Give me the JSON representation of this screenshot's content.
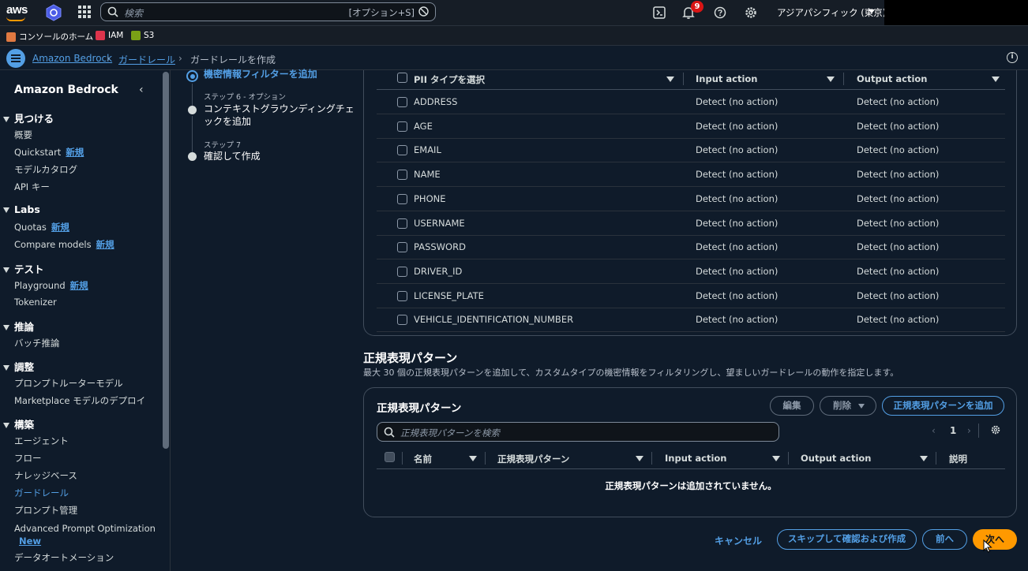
{
  "topnav": {
    "search_placeholder": "検索",
    "search_shortcut": "[オプション+S]",
    "notification_count": "9",
    "region": "アジアパシフィック (東京)"
  },
  "favorites": [
    {
      "label": "コンソールのホーム",
      "color": "#e07941"
    },
    {
      "label": "IAM",
      "color": "#dd344c"
    },
    {
      "label": "S3",
      "color": "#7aa116"
    }
  ],
  "breadcrumb": {
    "items": [
      "Amazon Bedrock",
      "ガードレール"
    ],
    "current": "ガードレールを作成"
  },
  "sidebar": {
    "title": "Amazon Bedrock",
    "sections": [
      {
        "title": "見つける",
        "items": [
          {
            "label": "概要"
          },
          {
            "label": "Quickstart",
            "tag": "新規"
          },
          {
            "label": "モデルカタログ"
          },
          {
            "label": "API キー"
          }
        ]
      },
      {
        "title": "Labs",
        "items": [
          {
            "label": "Quotas",
            "tag": "新規"
          },
          {
            "label": "Compare models",
            "tag": "新規"
          }
        ]
      },
      {
        "title": "テスト",
        "items": [
          {
            "label": "Playground",
            "tag": "新規"
          },
          {
            "label": "Tokenizer"
          }
        ]
      },
      {
        "title": "推論",
        "items": [
          {
            "label": "バッチ推論"
          }
        ]
      },
      {
        "title": "調整",
        "items": [
          {
            "label": "プロンプトルーターモデル"
          },
          {
            "label": "Marketplace モデルのデプロイ"
          }
        ]
      },
      {
        "title": "構築",
        "items": [
          {
            "label": "エージェント"
          },
          {
            "label": "フロー"
          },
          {
            "label": "ナレッジベース"
          },
          {
            "label": "ガードレール",
            "active": true
          },
          {
            "label": "プロンプト管理"
          },
          {
            "label": "Advanced Prompt Optimization",
            "tag": "New"
          },
          {
            "label": "データオートメーション"
          }
        ]
      }
    ]
  },
  "steps": {
    "active": "機密情報フィルターを追加",
    "step6_label": "ステップ 6 - オプション",
    "step6_name_l1": "コンテキストグラウンディングチェ",
    "step6_name_l2": "ックを追加",
    "step7_label": "ステップ 7",
    "step7_name": "確認して作成"
  },
  "pii_table": {
    "headers": [
      "PII タイプを選択",
      "Input action",
      "Output action"
    ],
    "rows": [
      [
        "ADDRESS",
        "Detect (no action)",
        "Detect (no action)"
      ],
      [
        "AGE",
        "Detect (no action)",
        "Detect (no action)"
      ],
      [
        "EMAIL",
        "Detect (no action)",
        "Detect (no action)"
      ],
      [
        "NAME",
        "Detect (no action)",
        "Detect (no action)"
      ],
      [
        "PHONE",
        "Detect (no action)",
        "Detect (no action)"
      ],
      [
        "USERNAME",
        "Detect (no action)",
        "Detect (no action)"
      ],
      [
        "PASSWORD",
        "Detect (no action)",
        "Detect (no action)"
      ],
      [
        "DRIVER_ID",
        "Detect (no action)",
        "Detect (no action)"
      ],
      [
        "LICENSE_PLATE",
        "Detect (no action)",
        "Detect (no action)"
      ],
      [
        "VEHICLE_IDENTIFICATION_NUMBER",
        "Detect (no action)",
        "Detect (no action)"
      ]
    ]
  },
  "regex": {
    "section_title": "正規表現パターン",
    "description": "最大 30 個の正規表現パターンを追加して、カスタムタイプの機密情報をフィルタリングし、望ましいガードレールの動作を指定します。",
    "card_title": "正規表現パターン",
    "edit_label": "編集",
    "delete_label": "削除",
    "add_label": "正規表現パターンを追加",
    "search_placeholder": "正規表現パターンを検索",
    "page": "1",
    "headers": [
      "名前",
      "正規表現パターン",
      "Input action",
      "Output action",
      "説明"
    ],
    "empty": "正規表現パターンは追加されていません。"
  },
  "footer": {
    "cancel": "キャンセル",
    "skip": "スキップして確認および作成",
    "prev": "前へ",
    "next": "次へ"
  }
}
